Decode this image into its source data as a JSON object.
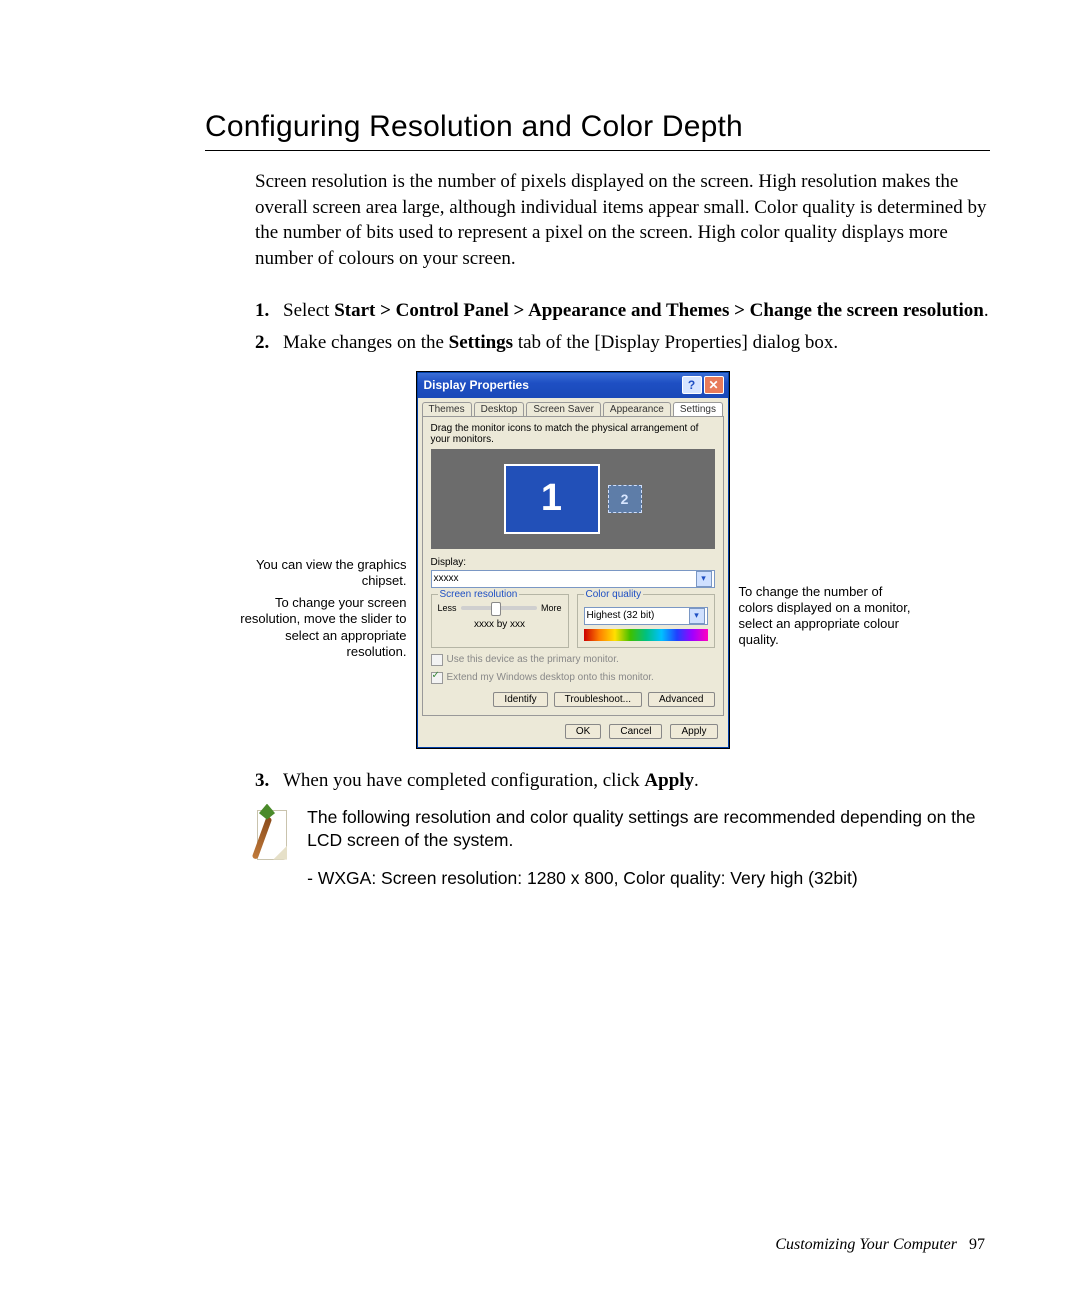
{
  "title": "Configuring Resolution and Color Depth",
  "intro": "Screen resolution is the number of pixels displayed on the screen. High resolution makes the overall screen area large, although individual items appear small. Color quality is determined by the number of bits used to represent a pixel on the screen. High color quality displays more number of colours on your screen.",
  "steps": {
    "s1_pre": "Select ",
    "s1_bold": "Start > Control Panel > Appearance and Themes > Change the screen resolution",
    "s1_post": ".",
    "s2_a": "Make changes on the ",
    "s2_bold": "Settings",
    "s2_b": " tab of the [Display Properties] dialog box.",
    "s3_a": "When you have completed configuration, click ",
    "s3_bold": "Apply",
    "s3_b": "."
  },
  "callouts": {
    "left1": "You can view the graphics chipset.",
    "left2": "To change your screen resolution, move the slider to select an appropriate resolution.",
    "right1": "To change the number of colors displayed on a monitor, select an appropriate colour quality."
  },
  "dialog": {
    "title": "Display Properties",
    "tabs": [
      "Themes",
      "Desktop",
      "Screen Saver",
      "Appearance",
      "Settings"
    ],
    "hint": "Drag the monitor icons to match the physical arrangement of your monitors.",
    "mon1": "1",
    "mon2": "2",
    "display_label": "Display:",
    "display_value": "xxxxx",
    "res_legend": "Screen resolution",
    "less": "Less",
    "more": "More",
    "res_value": "xxxx by xxx",
    "cq_legend": "Color quality",
    "cq_value": "Highest (32 bit)",
    "chk1": "Use this device as the primary monitor.",
    "chk2": "Extend my Windows desktop onto this monitor.",
    "identify": "Identify",
    "troubleshoot": "Troubleshoot...",
    "advanced": "Advanced",
    "ok": "OK",
    "cancel": "Cancel",
    "apply": "Apply"
  },
  "note": {
    "line1": "The following resolution and color quality settings are recommended depending on the LCD screen of the system.",
    "line2": "- WXGA: Screen resolution: 1280 x 800, Color quality: Very high (32bit)"
  },
  "footer": {
    "text": "Customizing Your Computer",
    "page": "97"
  }
}
